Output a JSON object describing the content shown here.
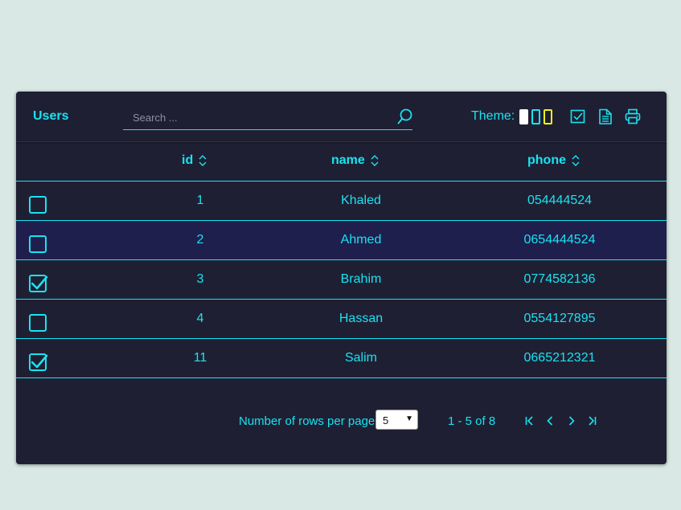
{
  "header": {
    "title": "Users",
    "search_placeholder": "Search ...",
    "theme_label": "Theme:",
    "theme_swatches": [
      {
        "name": "light",
        "fill": "#ffffff",
        "border": "#ffffff"
      },
      {
        "name": "cyan",
        "fill": "#1f1f33",
        "border": "#19e3f0"
      },
      {
        "name": "yellow",
        "fill": "#1f1f33",
        "border": "#f5f11b"
      }
    ],
    "tools": [
      "select-all-icon",
      "document-icon",
      "print-icon"
    ]
  },
  "table": {
    "columns": [
      "id",
      "name",
      "phone"
    ],
    "rows": [
      {
        "checked": false,
        "id": "1",
        "name": "Khaled",
        "phone": "054444524"
      },
      {
        "checked": false,
        "id": "2",
        "name": "Ahmed",
        "phone": "0654444524"
      },
      {
        "checked": true,
        "id": "3",
        "name": "Brahim",
        "phone": "0774582136"
      },
      {
        "checked": false,
        "id": "4",
        "name": "Hassan",
        "phone": "0554127895"
      },
      {
        "checked": true,
        "id": "11",
        "name": "Salim",
        "phone": "0665212321"
      }
    ]
  },
  "footer": {
    "rows_per_page_label": "Number of rows per page",
    "rows_per_page_value": "5",
    "range_label": "1 - 5 of 8"
  },
  "colors": {
    "background": "#d9e8e4",
    "card": "#1f1f33",
    "accent": "#19e3f0",
    "highlight_row": "#1e1f4d"
  }
}
